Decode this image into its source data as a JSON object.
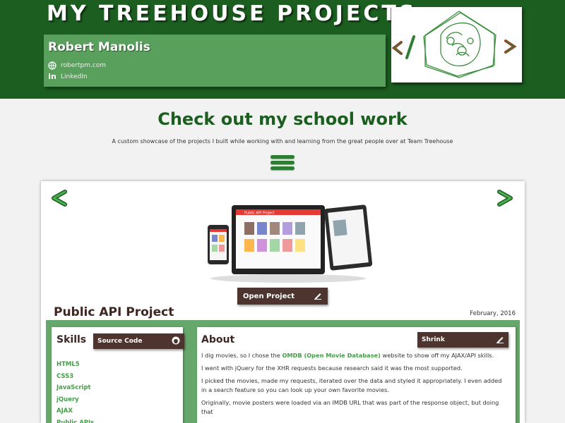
{
  "header": {
    "site_title": "MY TREEHOUSE PROJECTS",
    "name": "Robert Manolis",
    "website_label": "robertpm.com",
    "linkedin_label": "LinkedIn",
    "linkedin_icon": "in"
  },
  "intro": {
    "title": "Check out my school work",
    "subtitle": "A custom showcase of the projects I built while working with and learning from the great people over at Team Treehouse"
  },
  "project": {
    "preview_title": "Public API Project",
    "open_button": "Open Project",
    "title": "Public API Project",
    "date": "February, 2016",
    "skills_heading": "Skills",
    "source_button": "Source Code",
    "skills": [
      "HTML5",
      "CSS3",
      "JavaScript",
      "jQuery",
      "AJAX",
      "Public APIs"
    ],
    "about_heading": "About",
    "shrink_button": "Shrink",
    "about": {
      "p1_before": "I dig movies, so I chose the ",
      "p1_link": "OMDB (Open Movie Database)",
      "p1_after": " website to show off my AJAX/API skills.",
      "p2": "I went with jQuery for the XHR requests because research said it was the most supported.",
      "p3": "I picked the movies, made my requests, iterated over the data and styled it appropriately. I even added in a search feature so you can look up your own favorite movies.",
      "p4": "Originally, movie posters were loaded via an IMDB URL that was part of the response object, but doing that"
    }
  },
  "colors": {
    "header_green": "#1b5e20",
    "accent_green": "#66a86b",
    "button_brown": "#4e342e",
    "link_green": "#43a047"
  }
}
